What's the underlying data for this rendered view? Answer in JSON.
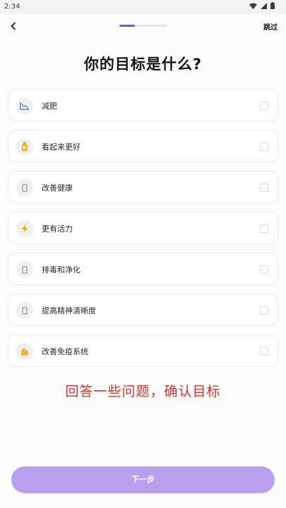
{
  "status_bar": {
    "time": "2:34"
  },
  "header": {
    "skip_label": "跳过",
    "progress": 0.33
  },
  "title": "你的目标是什么?",
  "options": [
    {
      "label": "减肥",
      "icon": "chart-down-icon",
      "glyph": "📉"
    },
    {
      "label": "看起来更好",
      "icon": "bottle-icon",
      "glyph": "🧴"
    },
    {
      "label": "改善健康",
      "icon": "heart-icon",
      "glyph": "▯"
    },
    {
      "label": "更有活力",
      "icon": "lightning-icon",
      "glyph": "⚡"
    },
    {
      "label": "排毒和净化",
      "icon": "leaf-icon",
      "glyph": "▯"
    },
    {
      "label": "提高精神清晰度",
      "icon": "brain-icon",
      "glyph": "▯"
    },
    {
      "label": "改善免疫系统",
      "icon": "flexed-biceps-icon",
      "glyph": "💪"
    }
  ],
  "overlay_caption": "回答一些问题，确认目标",
  "next_button_label": "下一步",
  "colors": {
    "accent": "#7b52d6",
    "button_disabled": "#b9a0ef",
    "caption": "#d3342b"
  }
}
